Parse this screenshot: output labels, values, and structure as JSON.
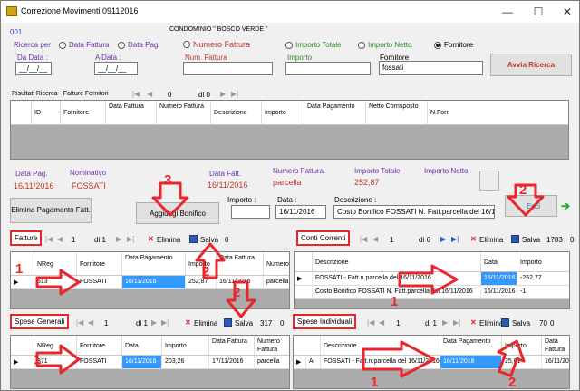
{
  "window": {
    "title": "Correzione Movimenti 09112016",
    "minimize": "—",
    "maximize": "☐",
    "close": "✕"
  },
  "header": {
    "code": "001",
    "condominio": "CONDOMINIO \" BOSCO VERDE \""
  },
  "search": {
    "ricerca_per": "Ricerca per",
    "radios": [
      {
        "label": "Data Fattura",
        "checked": false
      },
      {
        "label": "Data Pag.",
        "checked": false
      },
      {
        "label": "Numero Fattura",
        "checked": false
      },
      {
        "label": "Importo Totale",
        "checked": false
      },
      {
        "label": "Importo Netto",
        "checked": false
      },
      {
        "label": "Fornitore",
        "checked": true
      }
    ],
    "da_data_label": "Da Data :",
    "da_data_value": "__/__/__",
    "a_data_label": "A Data :",
    "a_data_value": "__/__/__",
    "num_fattura_label": "Num. Fattura",
    "num_fattura_value": "",
    "importo_label": "Importo",
    "importo_value": "",
    "fornitore_label": "Fornitore",
    "fornitore_value": "fossati",
    "avvia_button": "Avvia Ricerca"
  },
  "results": {
    "label": "Risultati Ricerca -  Fatture Fornitori",
    "nav": {
      "position": "0",
      "of": "di 0"
    },
    "columns": [
      "ID",
      "Fornitore",
      "Data Fattura",
      "Numero Fattura",
      "Descrizione",
      "Importo",
      "Data Pagamento",
      "Netto Corrisposto",
      "N.Forn"
    ]
  },
  "summary": {
    "data_pag_label": "Data Pag.",
    "data_pag_value": "16/11/2016",
    "nominativo_label": "Nominativo",
    "nominativo_value": "FOSSATI",
    "data_fatt_label": "Data Fatt.",
    "data_fatt_value": "16/11/2016",
    "numero_fattura_label": "Numero Fattura",
    "numero_fattura_value": "parcella",
    "importo_totale_label": "Importo Totale",
    "importo_totale_value": "252,87",
    "importo_netto_label": "Importo Netto",
    "importo_netto_value": ""
  },
  "actions": {
    "elimina_pagamento": "Elimina Pagamento Fatt.",
    "aggiungi_bonifico": "Aggiungi Bonifico",
    "importo_label": "Importo :",
    "importo_value": "",
    "data_label": "Data :",
    "data_value": "16/11/2016",
    "descrizione_label": "Descrizione :",
    "descrizione_value": "Costo Bonifico FOSSATI N. Fatt.parcella del 16/11/2016",
    "esci": "Esci"
  },
  "fatture": {
    "tag": "Fatture",
    "position": "1",
    "of": "di 1",
    "elimina": "Elimina",
    "salva": "Salva",
    "extra": "0",
    "columns": [
      "NReg",
      "Fornitore",
      "Data Pagamento",
      "Importo",
      "Data Fattura",
      "Numero"
    ],
    "rows": [
      {
        "nreg": "513",
        "fornitore": "FOSSATI",
        "data_pag": "16/11/2016",
        "importo": "252,87",
        "data_fatt": "16/11/2016",
        "numero": "parcella"
      }
    ]
  },
  "conti": {
    "tag": "Conti Correnti",
    "position": "1",
    "of": "di 6",
    "elimina": "Elimina",
    "salva": "Salva",
    "extra": "1783",
    "extra2": "0",
    "columns": [
      "Descrizione",
      "Data",
      "Importo"
    ],
    "rows": [
      {
        "descrizione": "FOSSATI - Fatt.n.parcella del 16/11/2016",
        "data": "16/11/2016",
        "importo": "-252,77"
      },
      {
        "descrizione": "Costo Bonifico FOSSATI N. Fatt.parcella del 16/11/2016",
        "data": "16/11/2016",
        "importo": "-1"
      }
    ]
  },
  "spese_generali": {
    "tag": "Spese Generali",
    "position": "1",
    "of": "di 1",
    "elimina": "Elimina",
    "salva": "Salva",
    "extra": "317",
    "extra2": "0",
    "columns": [
      "NReg",
      "Fornitore",
      "Data",
      "Importo",
      "Data Fattura",
      "Numero Fattura"
    ],
    "rows": [
      {
        "nreg": "371",
        "fornitore": "FOSSATI",
        "data": "16/11/2016",
        "importo": "203,26",
        "data_fatt": "17/11/2016",
        "numero": "parcella"
      }
    ]
  },
  "spese_individuali": {
    "tag": "Spese Individuali",
    "position": "1",
    "of": "di 1",
    "elimina": "Elimina",
    "salva": "Salva",
    "extra": "70",
    "extra2": "0",
    "columns": [
      "Descrizione",
      "Data Pagamento",
      "Importo",
      "Data Fattura"
    ],
    "rows": [
      {
        "flag": "A",
        "descrizione": "FOSSATI - Fatt.n.parcella del 16/11/2016",
        "data_pag": "16/11/2016",
        "importo": "25,61",
        "data_fatt": "16/11/201"
      }
    ]
  },
  "annotations": {
    "n1": "1",
    "n2": "2",
    "n3": "3"
  },
  "colors": {
    "accent_red": "#e8262b",
    "selection_blue": "#3399ff",
    "label_purple": "#6a2fb0",
    "value_red": "#c0392b"
  }
}
